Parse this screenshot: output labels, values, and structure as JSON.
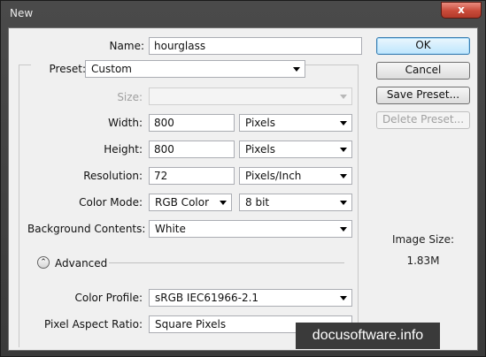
{
  "window": {
    "title": "New",
    "close_glyph": "x"
  },
  "fields": {
    "name": {
      "label": "Name:",
      "value": "hourglass"
    },
    "preset": {
      "label": "Preset:",
      "value": "Custom"
    },
    "size": {
      "label": "Size:",
      "value": ""
    },
    "width": {
      "label": "Width:",
      "value": "800",
      "unit": "Pixels"
    },
    "height": {
      "label": "Height:",
      "value": "800",
      "unit": "Pixels"
    },
    "resolution": {
      "label": "Resolution:",
      "value": "72",
      "unit": "Pixels/Inch"
    },
    "color_mode": {
      "label": "Color Mode:",
      "value": "RGB Color",
      "depth": "8 bit"
    },
    "background": {
      "label": "Background Contents:",
      "value": "White"
    },
    "advanced": {
      "label": "Advanced",
      "toggle_glyph": "⌃"
    },
    "color_profile": {
      "label": "Color Profile:",
      "value": "sRGB IEC61966-2.1"
    },
    "pixel_aspect": {
      "label": "Pixel Aspect Ratio:",
      "value": "Square Pixels"
    }
  },
  "buttons": {
    "ok": "OK",
    "cancel": "Cancel",
    "save_preset": "Save Preset...",
    "delete_preset": "Delete Preset..."
  },
  "image_size": {
    "label": "Image Size:",
    "value": "1.83M"
  },
  "watermark": "docusoftware.info"
}
